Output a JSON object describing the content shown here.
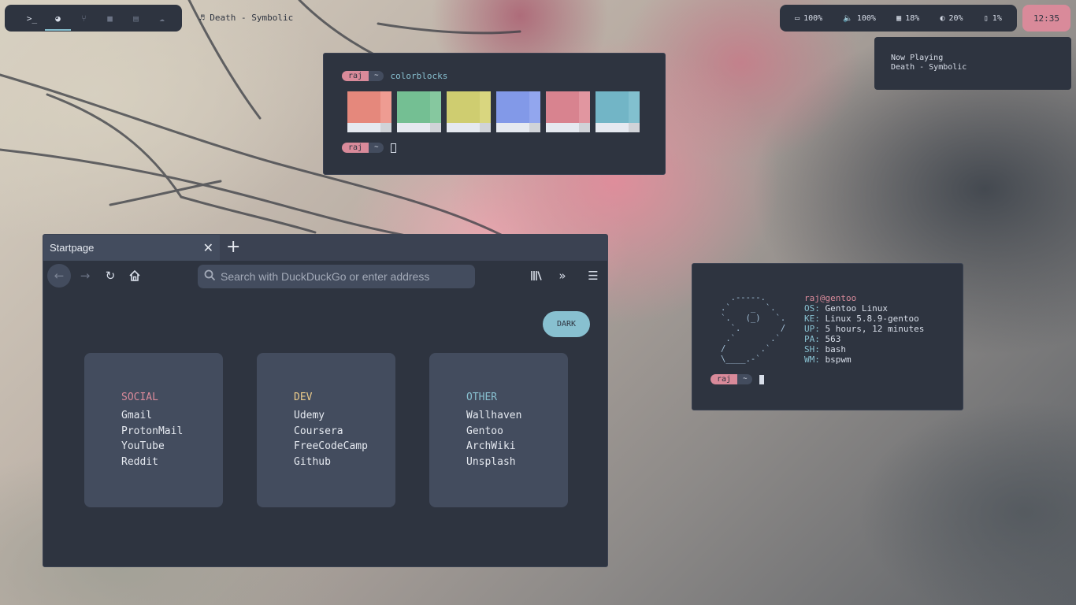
{
  "colors": {
    "bar_bg": "#2e3440",
    "accent_pink": "#d98a9a",
    "accent_cyan": "#88c0d0",
    "accent_yellow": "#ebcb8b",
    "text": "#d8dee9"
  },
  "topbar": {
    "workspaces": [
      {
        "icon": "terminal-icon",
        "glyph": ">_",
        "active": false
      },
      {
        "icon": "firefox-icon",
        "glyph": "◕",
        "active": true
      },
      {
        "icon": "git-branch-icon",
        "glyph": "⑂",
        "active": false
      },
      {
        "icon": "folder-icon",
        "glyph": "■",
        "active": false
      },
      {
        "icon": "film-icon",
        "glyph": "▤",
        "active": false
      },
      {
        "icon": "cloud-icon",
        "glyph": "☁",
        "active": false
      }
    ],
    "now_title_icon": "music-note-icon",
    "now_title": "Death - Symbolic",
    "stats": [
      {
        "icon": "battery-icon",
        "glyph": "▭",
        "value": "100%"
      },
      {
        "icon": "volume-icon",
        "glyph": "🔈",
        "value": "100%"
      },
      {
        "icon": "memory-icon",
        "glyph": "▦",
        "value": "18%"
      },
      {
        "icon": "brightness-icon",
        "glyph": "◐",
        "value": "20%"
      },
      {
        "icon": "cpu-icon",
        "glyph": "▯",
        "value": "1%"
      }
    ],
    "clock": "12:35"
  },
  "now_playing": {
    "label": "Now Playing",
    "track": "Death - Symbolic"
  },
  "terminal_colorblocks": {
    "user": "raj",
    "dir": "~",
    "command": "colorblocks",
    "blocks": [
      {
        "main": "#e5887c",
        "side": "#ee9c92"
      },
      {
        "main": "#74bf93",
        "side": "#86c89f"
      },
      {
        "main": "#cfcd70",
        "side": "#d9d67f"
      },
      {
        "main": "#8299e8",
        "side": "#92a6ee"
      },
      {
        "main": "#d8838f",
        "side": "#e196a0"
      },
      {
        "main": "#72b5c6",
        "side": "#82c0cf"
      }
    ]
  },
  "browser": {
    "tab_title": "Startpage",
    "url_placeholder": "Search with DuckDuckGo or enter address",
    "dark_button": "DARK",
    "cards": [
      {
        "title": "SOCIAL",
        "color": "#d98a9a",
        "links": [
          "Gmail",
          "ProtonMail",
          "YouTube",
          "Reddit"
        ]
      },
      {
        "title": "DEV",
        "color": "#ebcb8b",
        "links": [
          "Udemy",
          "Coursera",
          "FreeCodeCamp",
          "Github"
        ]
      },
      {
        "title": "OTHER",
        "color": "#88c0d0",
        "links": [
          "Wallhaven",
          "Gentoo",
          "ArchWiki",
          "Unsplash"
        ]
      }
    ]
  },
  "neofetch": {
    "ascii": "  .-----.\n.`    _  `.\n`.   (_)   `.\n  `.        /\n .`       .`\n/       .`\n\\____.-`",
    "user_host": "raj@gentoo",
    "rows": [
      {
        "key": "OS",
        "value": "Gentoo Linux"
      },
      {
        "key": "KE",
        "value": "Linux 5.8.9-gentoo"
      },
      {
        "key": "UP",
        "value": "5 hours, 12 minutes"
      },
      {
        "key": "PA",
        "value": "563"
      },
      {
        "key": "SH",
        "value": "bash"
      },
      {
        "key": "WM",
        "value": "bspwm"
      }
    ],
    "prompt_user": "raj",
    "prompt_dir": "~"
  }
}
